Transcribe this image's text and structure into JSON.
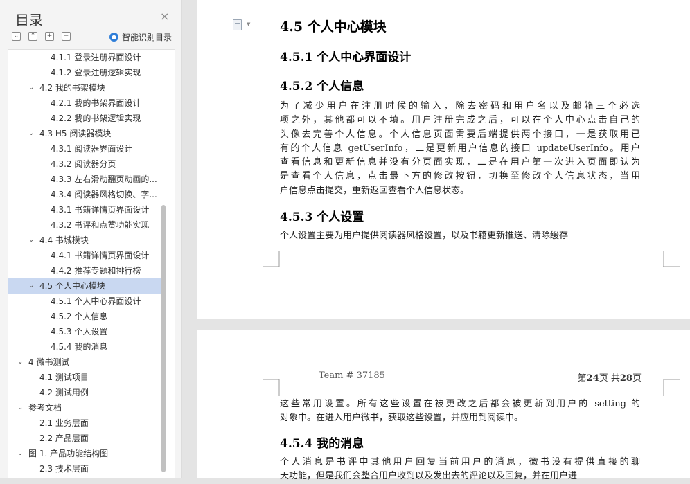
{
  "sidebar": {
    "title": "目录",
    "smart_toc_label": "智能识别目录",
    "toc": [
      {
        "label": "4.1.1  登录注册界面设计",
        "level": 3
      },
      {
        "label": "4.1.2  登录注册逻辑实现",
        "level": 3
      },
      {
        "label": "4.2  我的书架模块",
        "level": 2,
        "expanded": true
      },
      {
        "label": "4.2.1  我的书架界面设计",
        "level": 3
      },
      {
        "label": "4.2.2  我的书架逻辑实现",
        "level": 3
      },
      {
        "label": "4.3 H5 阅读器模块",
        "level": 2,
        "expanded": true
      },
      {
        "label": "4.3.1  阅读器界面设计",
        "level": 3
      },
      {
        "label": "4.3.2  阅读器分页",
        "level": 3
      },
      {
        "label": "4.3.3  左右滑动翻页动画的...",
        "level": 3
      },
      {
        "label": "4.3.4  阅读器风格切换、字...",
        "level": 3
      },
      {
        "label": "4.3.1  书籍详情页界面设计",
        "level": 3
      },
      {
        "label": "4.3.2  书评和点赞功能实现",
        "level": 3
      },
      {
        "label": "4.4  书城模块",
        "level": 2,
        "expanded": true
      },
      {
        "label": "4.4.1  书籍详情页界面设计",
        "level": 3
      },
      {
        "label": "4.4.2  推荐专题和排行榜",
        "level": 3
      },
      {
        "label": "4.5  个人中心模块",
        "level": 2,
        "expanded": true,
        "selected": true
      },
      {
        "label": "4.5.1  个人中心界面设计",
        "level": 3
      },
      {
        "label": "4.5.2  个人信息",
        "level": 3
      },
      {
        "label": "4.5.3  个人设置",
        "level": 3
      },
      {
        "label": "4.5.4  我的消息",
        "level": 3
      },
      {
        "label": "4  微书测试",
        "level": 1,
        "expanded": true
      },
      {
        "label": "4.1  测试项目",
        "level": 2
      },
      {
        "label": "4.2  测试用例",
        "level": 2
      },
      {
        "label": "参考文档",
        "level": 1,
        "expanded": true
      },
      {
        "label": "2.1  业务层面",
        "level": 2
      },
      {
        "label": "2.2  产品层面",
        "level": 2
      },
      {
        "label": "图 1. 产品功能结构图",
        "level": 1,
        "expanded": true
      },
      {
        "label": "2.3  技术层面",
        "level": 2
      }
    ]
  },
  "page1": {
    "h1": "4.5  个人中心模块",
    "h2": "4.5.1  个人中心界面设计",
    "h3": "4.5.2  个人信息",
    "para1_lines": [
      "    为了减少用户在注册时候的输入，除去密码和用户名以及邮箱三个必选",
      "项之外，其他都可以不填。用户注册完成之后，可以在个人中心点击自己的",
      "头像去完善个人信息。个人信息页面需要后端提供两个接口，一是获取用已",
      "有的个人信息 getUserInfo，二是更新用户信息的接口 updateUserInfo。用户",
      "查看信息和更新信息并没有分页面实现，二是在用户第一次进入页面即认为",
      "是查看个人信息，点击最下方的修改按钮，切换至修改个人信息状态，当用",
      "户信息点击提交，重新返回查看个人信息状态。"
    ],
    "h4": "4.5.3  个人设置",
    "para2_lines": [
      "    个人设置主要为用户提供阅读器风格设置，以及书籍更新推送、清除缓存"
    ]
  },
  "page2": {
    "header_team": "Team # 37185",
    "header_page_prefix": "第",
    "header_page_current": "24",
    "header_page_mid": "页 共",
    "header_page_total": "28",
    "header_page_suffix": "页",
    "para_lines": [
      "这些常用设置。所有这些设置在被更改之后都会被更新到用户的 setting 的",
      "对象中。在进入用户微书，获取这些设置，并应用到阅读中。"
    ],
    "h5": "4.5.4  我的消息",
    "para3_lines": [
      "    个人消息是书评中其他用户回复当前用户的消息，微书没有提供直接的聊",
      "天功能，但是我们会整合用户收到以及发出去的评论以及回复，并在用户进"
    ]
  },
  "colors": {
    "selection": "#c9d8f1",
    "page_bg": "#ffffff",
    "canvas_bg": "#e4e4e4",
    "smart_icon": "#2f7ed8"
  }
}
